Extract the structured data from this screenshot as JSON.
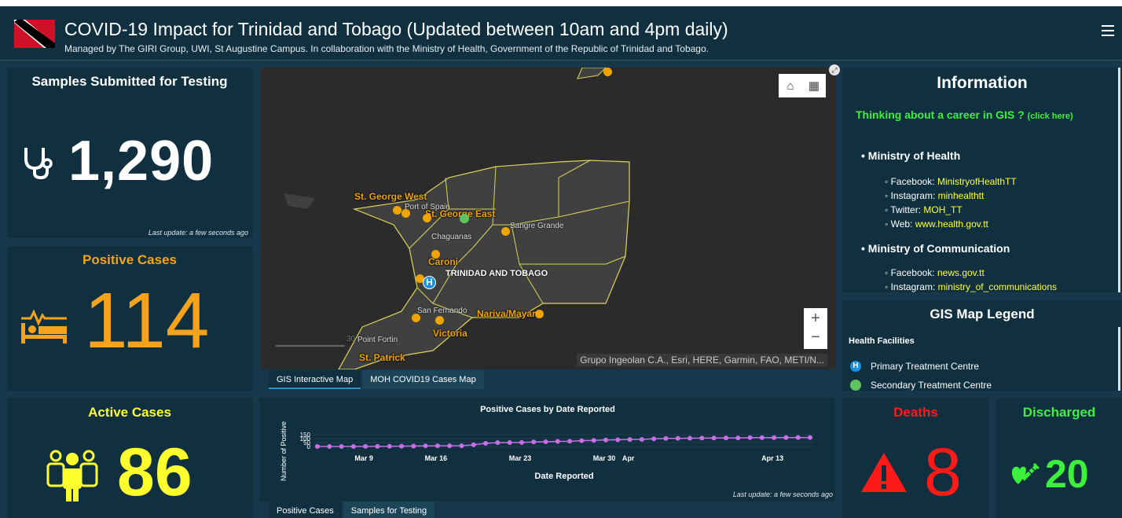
{
  "header": {
    "title": "COVID-19 Impact for Trinidad and Tobago (Updated between 10am and 4pm daily)",
    "subtitle": "Managed by The GIRI Group, UWI, St Augustine Campus. In collaboration with the Ministry of Health, Government of the Republic of Trinidad and Tobago.",
    "menu_icon": "hamburger-icon"
  },
  "samples": {
    "title": "Samples Submitted for Testing",
    "value": "1,290",
    "last_update": "Last update: a few seconds ago",
    "icon": "stethoscope-icon"
  },
  "positive": {
    "title": "Positive Cases",
    "value": "114",
    "icon": "hospital-bed-icon"
  },
  "active": {
    "title": "Active Cases",
    "value": "86",
    "icon": "people-icon"
  },
  "deaths": {
    "title": "Deaths",
    "value": "8",
    "icon": "warning-icon"
  },
  "discharged": {
    "title": "Discharged",
    "value": "20",
    "icon": "syringe-heart-icon"
  },
  "map": {
    "labels": {
      "st_george_west": "St. George West",
      "port_of_spain": "Port of Spain",
      "st_george_east": "St. George East",
      "chaguanas": "Chaguanas",
      "sangre_grande": "Sangre Grande",
      "caroni": "Caroni",
      "country": "TRINIDAD AND TOBAGO",
      "san_fernando": "San Fernando",
      "nariva": "Nariva/Mayaro",
      "victoria": "Victoria",
      "point_fortin": "Point Fortin",
      "st_patrick": "St. Patrick",
      "scale": "30"
    },
    "attribution": "Grupo Ingeolan C.A., Esri, HERE, Garmin, FAO, METI/N...",
    "zoom_in": "+",
    "zoom_out": "−",
    "tabs": [
      "GIS Interactive Map",
      "MOH COVID19 Cases Map"
    ]
  },
  "info": {
    "title": "Information",
    "career_link": "Thinking about a career in GIS ?",
    "career_click": "(click here)",
    "moh": {
      "heading": "Ministry of Health",
      "facebook_label": "Facebook: ",
      "facebook": "MinistryofHealthTT",
      "instagram_label": "Instagram: ",
      "instagram": "minhealthtt",
      "twitter_label": "Twitter: ",
      "twitter": "MOH_TT",
      "web_label": "Web: ",
      "web": "www.health.gov.tt"
    },
    "moc": {
      "heading": "Ministry of Communication",
      "facebook_label": "Facebook: ",
      "facebook": "news.gov.tt",
      "instagram_label": "Instagram: ",
      "instagram": "ministry_of_communications"
    }
  },
  "legend": {
    "title": "GIS Map Legend",
    "section": "Health Facilities",
    "primary": "Primary Treatment Centre",
    "primary_icon": "H",
    "secondary": "Secondary Treatment Centre"
  },
  "chart_data": {
    "type": "line",
    "title": "Positive Cases by Date Reported",
    "xlabel": "Date Reported",
    "ylabel": "Number of Positive",
    "yticks": [
      "150",
      "100",
      "50",
      "0"
    ],
    "xticks": [
      "Mar 9",
      "Mar 16",
      "Mar 23",
      "Mar 30",
      "Apr",
      "Apr 13"
    ],
    "ylim": [
      0,
      150
    ],
    "x": [
      "Mar 1",
      "Mar 4",
      "Mar 6",
      "Mar 8",
      "Mar 10",
      "Mar 11",
      "Mar 12",
      "Mar 13",
      "Mar 14",
      "Mar 15",
      "Mar 16",
      "Mar 17",
      "Mar 18",
      "Mar 19",
      "Mar 20",
      "Mar 21",
      "Mar 22",
      "Mar 23",
      "Mar 24",
      "Mar 25",
      "Mar 26",
      "Mar 27",
      "Mar 28",
      "Mar 29",
      "Mar 30",
      "Mar 31",
      "Apr 1",
      "Apr 2",
      "Apr 3",
      "Apr 4",
      "Apr 5",
      "Apr 6",
      "Apr 7",
      "Apr 8",
      "Apr 9",
      "Apr 10",
      "Apr 11",
      "Apr 12",
      "Apr 13",
      "Apr 14",
      "Apr 15",
      "Apr 16"
    ],
    "values": [
      0,
      0,
      0,
      0,
      1,
      1,
      2,
      4,
      5,
      7,
      9,
      9,
      9,
      21,
      40,
      49,
      50,
      51,
      57,
      60,
      65,
      66,
      74,
      78,
      82,
      85,
      89,
      90,
      98,
      103,
      104,
      105,
      106,
      107,
      109,
      109,
      112,
      113,
      113,
      114,
      114,
      114
    ],
    "color": "#c86ee8"
  },
  "chart_last_update": "Last update: a few seconds ago",
  "chart_tabs": [
    "Positive Cases",
    "Samples for Testing"
  ],
  "colors": {
    "bg": "#17374a",
    "panel": "#10303f",
    "orange": "#f7a21b",
    "yellow": "#ffff2e",
    "red": "#ff1a1a",
    "green": "#3cf03c"
  }
}
